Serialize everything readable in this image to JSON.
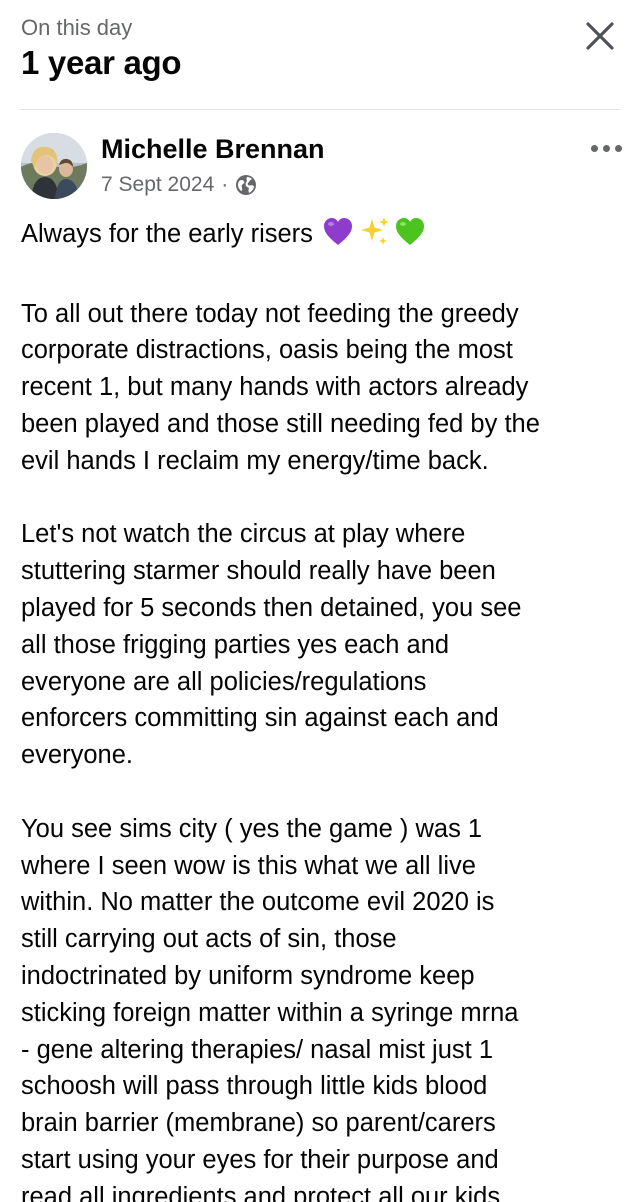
{
  "header": {
    "subtitle": "On this day",
    "title": "1 year ago"
  },
  "icons": {
    "close": "close-icon",
    "more": "more-options-icon",
    "privacy": "globe-icon"
  },
  "post": {
    "author": "Michelle Brennan",
    "date": "7 Sept 2024",
    "separator": "·",
    "emojis": [
      "purple-heart",
      "sparkles",
      "green-heart"
    ],
    "lines": [
      "Always for the early risers",
      "",
      "To all out there today not feeding the greedy",
      "corporate distractions, oasis being the most",
      "recent 1, but many hands with actors already",
      "been played and those still needing fed by the",
      "evil hands I reclaim my energy/time back.",
      "",
      "Let's not watch the circus at play where",
      "stuttering starmer should really have been",
      "played for 5 seconds then detained, you see",
      "all those frigging parties yes each and",
      "everyone are all policies/regulations",
      "enforcers committing sin against each and",
      "everyone.",
      "",
      "You see sims city ( yes the game ) was 1",
      "where I seen wow is this what we all live",
      "within. No matter the outcome evil 2020 is",
      "still carrying out acts of sin, those",
      "indoctrinated by uniform syndrome keep",
      "sticking foreign matter within a syringe mrna",
      "- gene altering therapies/ nasal mist just 1",
      "schoosh will pass through little kids blood",
      "brain barrier (membrane) so parent/carers",
      "start using your eyes for their purpose and",
      "read all ingredients and protect all our kids."
    ]
  },
  "colors": {
    "secondary_text": "#65676b",
    "primary_text": "#050505",
    "divider": "#e4e6eb",
    "purple_heart": "#8e3ccb",
    "green_heart": "#4cc31e",
    "sparkle": "#f7d02b"
  }
}
